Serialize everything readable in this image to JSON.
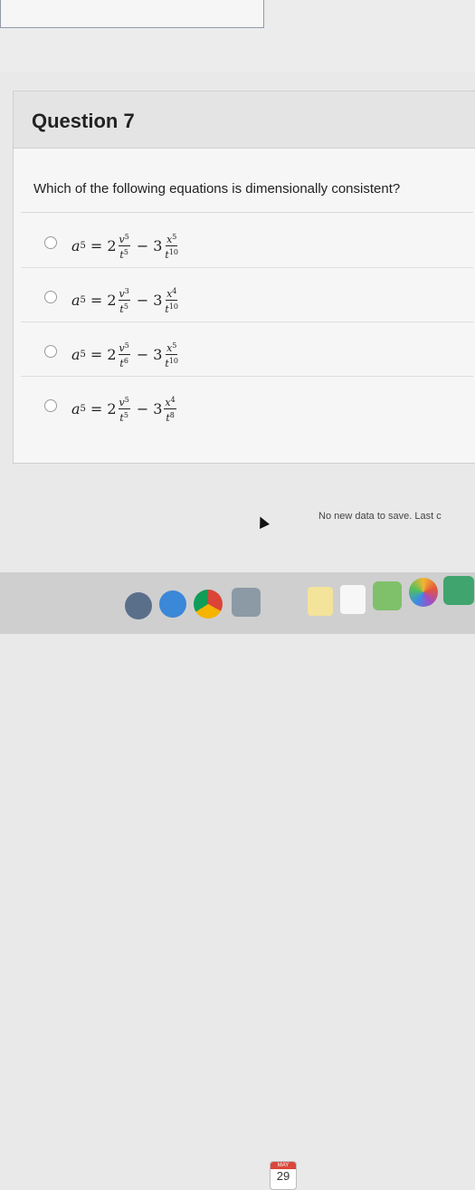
{
  "question": {
    "title": "Question 7",
    "text": "Which of the following equations is dimensionally consistent?"
  },
  "answers": [
    {
      "lhs": "a",
      "lhs_exp": "5",
      "c1": "2",
      "n1": "v",
      "n1e": "5",
      "d1": "t",
      "d1e": "5",
      "op": "−",
      "c2": "3",
      "n2": "x",
      "n2e": "5",
      "d2": "t",
      "d2e": "10"
    },
    {
      "lhs": "a",
      "lhs_exp": "5",
      "c1": "2",
      "n1": "v",
      "n1e": "3",
      "d1": "t",
      "d1e": "5",
      "op": "−",
      "c2": "3",
      "n2": "x",
      "n2e": "4",
      "d2": "t",
      "d2e": "10"
    },
    {
      "lhs": "a",
      "lhs_exp": "5",
      "c1": "2",
      "n1": "v",
      "n1e": "5",
      "d1": "t",
      "d1e": "6",
      "op": "−",
      "c2": "3",
      "n2": "x",
      "n2e": "5",
      "d2": "t",
      "d2e": "10"
    },
    {
      "lhs": "a",
      "lhs_exp": "5",
      "c1": "2",
      "n1": "v",
      "n1e": "5",
      "d1": "t",
      "d1e": "5",
      "op": "−",
      "c2": "3",
      "n2": "x",
      "n2e": "4",
      "d2": "t",
      "d2e": "8"
    }
  ],
  "status": {
    "text": "No new data to save. Last c"
  },
  "dock": {
    "calendar_day": "29",
    "calendar_month": "MAY"
  },
  "colors": {
    "background": "#e9e9e9",
    "card": "#f6f6f6",
    "header": "#e4e4e4"
  }
}
